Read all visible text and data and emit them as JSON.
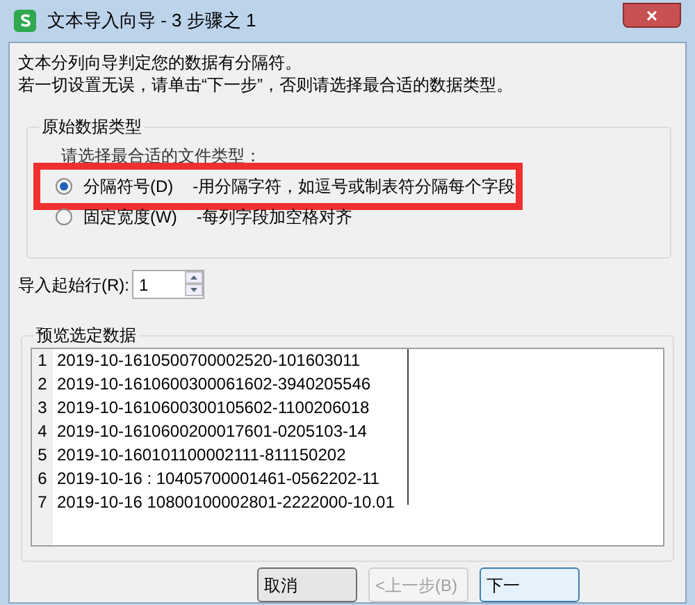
{
  "window": {
    "title": "文本导入向导 - 3 步骤之 1",
    "close": "×"
  },
  "intro": [
    "文本分列向导判定您的数据有分隔符。",
    "若一切设置无误，请单击“下一步”，否则请选择最合适的数据类型。"
  ],
  "data_type": {
    "title": "原始数据类型",
    "prompt": "请选择最合适的文件类型：",
    "options": [
      {
        "label": "分隔符号(D)",
        "description": "-用分隔字符，如逗号或制表符分隔每个字段",
        "selected": true,
        "highlighted": true
      },
      {
        "label": "固定宽度(W)",
        "description": "-每列字段加空格对齐",
        "selected": false,
        "highlighted": false
      }
    ]
  },
  "start_row": {
    "label": "导入起始行(R):",
    "value": "1"
  },
  "preview": {
    "title": "预览选定数据",
    "rows": [
      {
        "number": "1",
        "text": "2019-10-1610500700002520-101603011"
      },
      {
        "number": "2",
        "text": "2019-10-1610600300061602-3940205546"
      },
      {
        "number": "3",
        "text": "2019-10-1610600300105602-1100206018"
      },
      {
        "number": "4",
        "text": "2019-10-1610600200017601-0205103-14"
      },
      {
        "number": "5",
        "text": "2019-10-160101100002111-811150202"
      },
      {
        "number": "6",
        "text": "2019-10-16 : 10405700001461-0562202-11"
      },
      {
        "number": "7",
        "text": "2019-10-16 10800100002801-2222000-10.01"
      }
    ]
  },
  "buttons": [
    {
      "label": "取消",
      "disabled": false,
      "default": false
    },
    {
      "label": "<上一步(B)",
      "disabled": true,
      "default": false
    },
    {
      "label": "下一",
      "disabled": false,
      "default": true
    }
  ]
}
